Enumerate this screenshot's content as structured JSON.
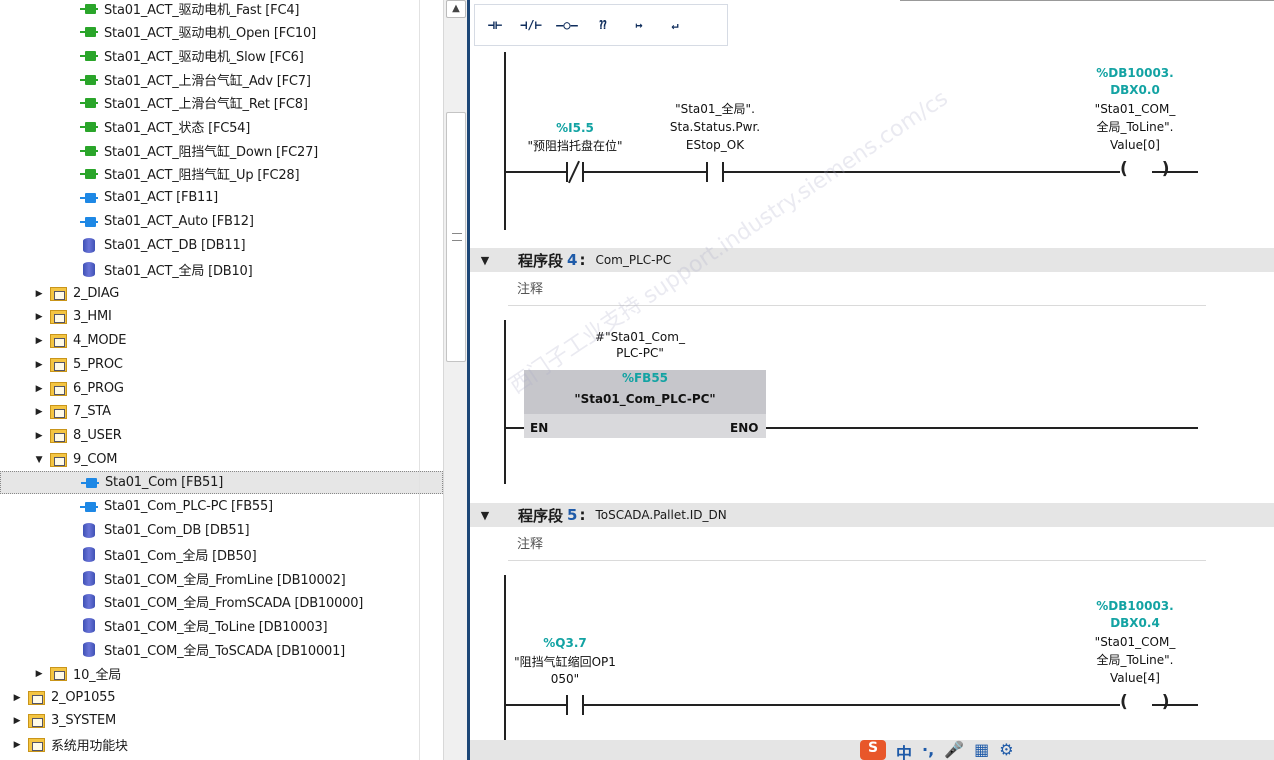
{
  "tree": {
    "items": [
      {
        "label": "Sta01_ACT_驱动电机_Fast [FC4]",
        "icon": "fc-icon"
      },
      {
        "label": "Sta01_ACT_驱动电机_Open [FC10]",
        "icon": "fc-icon"
      },
      {
        "label": "Sta01_ACT_驱动电机_Slow [FC6]",
        "icon": "fc-icon"
      },
      {
        "label": "Sta01_ACT_上滑台气缸_Adv [FC7]",
        "icon": "fc-icon"
      },
      {
        "label": "Sta01_ACT_上滑台气缸_Ret [FC8]",
        "icon": "fc-icon"
      },
      {
        "label": "Sta01_ACT_状态 [FC54]",
        "icon": "fc-icon"
      },
      {
        "label": "Sta01_ACT_阻挡气缸_Down [FC27]",
        "icon": "fc-icon"
      },
      {
        "label": "Sta01_ACT_阻挡气缸_Up [FC28]",
        "icon": "fc-icon"
      },
      {
        "label": "Sta01_ACT [FB11]",
        "icon": "fb-icon"
      },
      {
        "label": "Sta01_ACT_Auto [FB12]",
        "icon": "fb-icon"
      },
      {
        "label": "Sta01_ACT_DB [DB11]",
        "icon": "db-icon"
      },
      {
        "label": "Sta01_ACT_全局 [DB10]",
        "icon": "db-icon"
      },
      {
        "label": "2_DIAG",
        "icon": "folder-icon"
      },
      {
        "label": "3_HMI",
        "icon": "folder-icon"
      },
      {
        "label": "4_MODE",
        "icon": "folder-icon"
      },
      {
        "label": "5_PROC",
        "icon": "folder-icon"
      },
      {
        "label": "6_PROG",
        "icon": "folder-icon"
      },
      {
        "label": "7_STA",
        "icon": "folder-icon"
      },
      {
        "label": "8_USER",
        "icon": "folder-icon"
      },
      {
        "label": "9_COM",
        "icon": "folder-icon"
      },
      {
        "label": "Sta01_Com [FB51]",
        "icon": "fb-icon"
      },
      {
        "label": "Sta01_Com_PLC-PC [FB55]",
        "icon": "fb-icon"
      },
      {
        "label": "Sta01_Com_DB [DB51]",
        "icon": "db-icon"
      },
      {
        "label": "Sta01_Com_全局 [DB50]",
        "icon": "db-icon"
      },
      {
        "label": "Sta01_COM_全局_FromLine [DB10002]",
        "icon": "db-icon"
      },
      {
        "label": "Sta01_COM_全局_FromSCADA [DB10000]",
        "icon": "db-icon"
      },
      {
        "label": "Sta01_COM_全局_ToLine [DB10003]",
        "icon": "db-icon"
      },
      {
        "label": "Sta01_COM_全局_ToSCADA [DB10001]",
        "icon": "db-icon"
      },
      {
        "label": "10_全局",
        "icon": "folder-icon"
      },
      {
        "label": "2_OP1055",
        "icon": "folder-icon"
      },
      {
        "label": "3_SYSTEM",
        "icon": "folder-icon"
      },
      {
        "label": "系统用功能块",
        "icon": "folder-icon"
      }
    ]
  },
  "toolbar": {
    "buttons": [
      "⊣⊢",
      "⊣/⊢",
      "–○–",
      "⁇",
      "↦",
      "↵"
    ]
  },
  "network3": {
    "contact1_addr": "%I5.5",
    "contact1_name": "\"预阻挡托盘在位\"",
    "contact2_name_line1": "\"Sta01_全局\".",
    "contact2_name_line2": "Sta.Status.Pwr.",
    "contact2_name_line3": "EStop_OK",
    "coil_addr_line1": "%DB10003.",
    "coil_addr_line2": "DBX0.0",
    "coil_name_line1": "\"Sta01_COM_",
    "coil_name_line2": "全局_ToLine\".",
    "coil_name_line3": "Value[0]"
  },
  "network4": {
    "label": "程序段",
    "number": "4",
    "colon": ":",
    "title": "Com_PLC-PC",
    "comment": "注释",
    "instance_line1": "#\"Sta01_Com_",
    "instance_line2": "PLC-PC\"",
    "fb_addr": "%FB55",
    "fb_name": "\"Sta01_Com_PLC-PC\"",
    "en": "EN",
    "eno": "ENO"
  },
  "network5": {
    "label": "程序段",
    "number": "5",
    "colon": ":",
    "title": "ToSCADA.Pallet.ID_DN",
    "comment": "注释",
    "contact_addr": "%Q3.7",
    "contact_name_line1": "\"阻挡气缸缩回OP1",
    "contact_name_line2": "050\"",
    "coil_addr_line1": "%DB10003.",
    "coil_addr_line2": "DBX0.4",
    "coil_name_line1": "\"Sta01_COM_",
    "coil_name_line2": "全局_ToLine\".",
    "coil_name_line3": "Value[4]"
  },
  "watermark": "西门子工业支持 support.industry.siemens.com/cs",
  "ime": [
    "S",
    "中",
    "·,",
    "🎤",
    "▦",
    "⚙"
  ]
}
